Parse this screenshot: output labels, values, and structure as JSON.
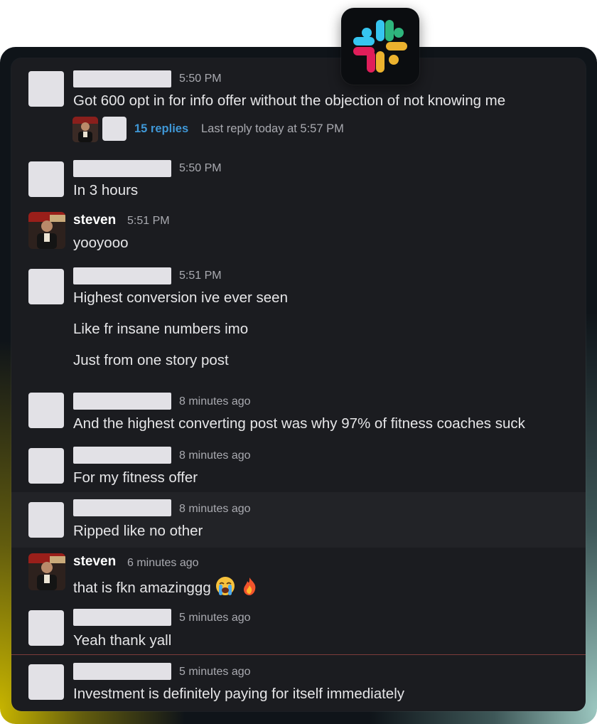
{
  "app": {
    "logo_icon": "slack-logo-icon"
  },
  "messages": [
    {
      "time": "5:50 PM",
      "lines": [
        "Got 600 opt in for info offer without the objection of not knowing me"
      ]
    },
    {
      "time": "5:50 PM",
      "lines": [
        "In 3 hours"
      ]
    },
    {
      "author": "steven",
      "time": "5:51 PM",
      "lines": [
        "yooyooo"
      ]
    },
    {
      "time": "5:51 PM",
      "lines": [
        "Highest conversion ive ever seen",
        "Like fr insane numbers imo",
        "Just from one story post"
      ]
    },
    {
      "time": "8 minutes ago",
      "lines": [
        "And the highest converting post was why 97% of fitness coaches suck"
      ]
    },
    {
      "time": "8 minutes ago",
      "lines": [
        "For my fitness offer"
      ]
    },
    {
      "time": "8 minutes ago",
      "lines": [
        "Ripped like no other"
      ]
    },
    {
      "author": "steven",
      "time": "6 minutes ago",
      "lines": [
        "that is fkn amazinggg"
      ],
      "emojis": [
        "loudly-crying-face-icon",
        "fire-icon"
      ]
    },
    {
      "time": "5 minutes ago",
      "lines": [
        "Yeah thank yall"
      ]
    },
    {
      "time": "5 minutes ago",
      "lines": [
        "Investment is definitely paying for itself immediately"
      ]
    }
  ],
  "thread": {
    "replies": "15 replies",
    "last_reply": "Last reply today at 5:57 PM"
  },
  "colors": {
    "background": "#1b1c20",
    "link": "#3f97d6",
    "timestamp": "#a9aab0",
    "new_divider": "#7c3b3b"
  }
}
